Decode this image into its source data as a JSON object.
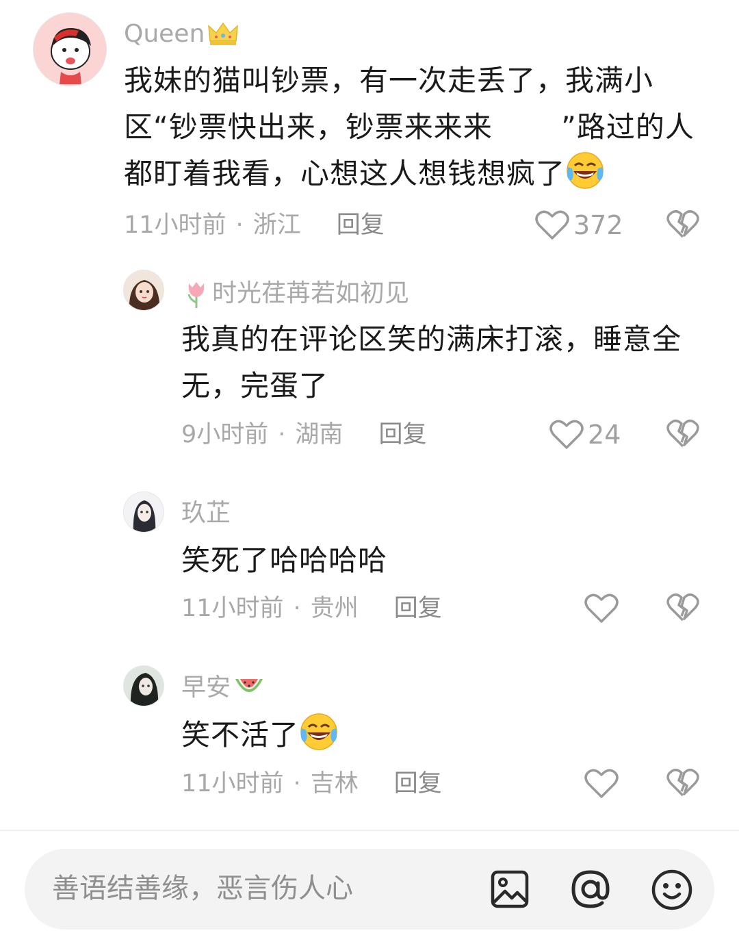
{
  "comments": [
    {
      "username": "Queen",
      "username_badge": "crown-icon",
      "lines": [
        "我妹的猫叫钞票，有一次走丢了，我满小",
        "区“钞票快出来，钞票来来来 　　”路过的人",
        "都盯着我看，心想这人想钱想疯了"
      ],
      "trailing_emoji": "laugh-cry-emoji",
      "time": "11小时前",
      "location": "浙江",
      "reply": "回复",
      "likes": "372"
    },
    {
      "username": "时光荏苒若如初见",
      "username_badge": "tulip-icon",
      "lines": [
        "我真的在评论区笑的满床打滚，睡意全",
        "无，完蛋了"
      ],
      "time": "9小时前",
      "location": "湖南",
      "reply": "回复",
      "likes": "24"
    },
    {
      "username": "玖芷",
      "lines": [
        "笑死了哈哈哈哈"
      ],
      "time": "11小时前",
      "location": "贵州",
      "reply": "回复",
      "likes": ""
    },
    {
      "username": "早安",
      "username_badge": "watermelon-icon",
      "lines": [
        "笑不活了"
      ],
      "trailing_emoji": "laugh-cry-emoji",
      "time": "11小时前",
      "location": "吉林",
      "reply": "回复",
      "likes": ""
    }
  ],
  "meta_separator": "·",
  "input": {
    "placeholder": "善语结善缘，恶言伤人心",
    "icons": [
      "image-icon",
      "at-icon",
      "emoji-icon"
    ]
  },
  "colors": {
    "text": "#1a1a1a",
    "secondary": "#a8a8a8",
    "input_bg": "#f3f3f3"
  }
}
